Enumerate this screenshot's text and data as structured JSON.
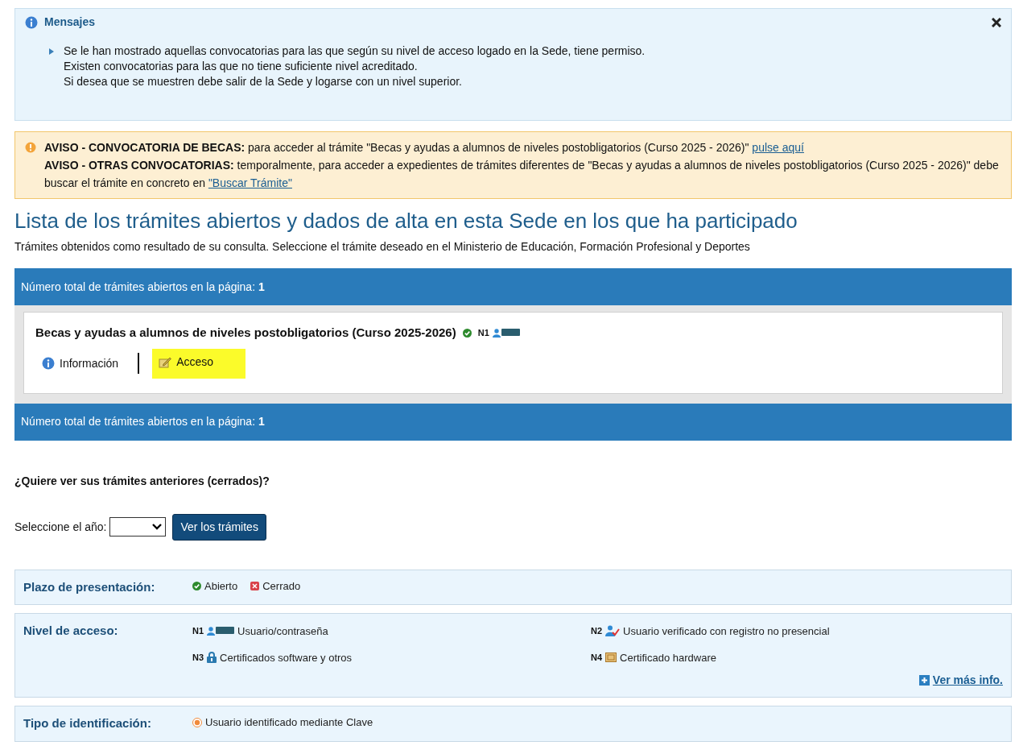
{
  "messages": {
    "title": "Mensajes",
    "items": [
      {
        "lines": [
          "Se le han mostrado aquellas convocatorias para las que según su nivel de acceso logado en la Sede, tiene permiso.",
          "Existen convocatorias para las que no tiene suficiente nivel acreditado.",
          "Si desea que se muestren debe salir de la Sede y logarse con un nivel superior."
        ]
      }
    ]
  },
  "notices": [
    {
      "text": "**AVISO - CONVOCATORIA DE BECAS:** para acceder al trámite \"Becas y ayudas a alumnos de niveles postobligatorios (Curso 2025 - 2026)\"",
      "link": "pulse aquí"
    },
    {
      "text": "**AVISO - OTRAS CONVOCATORIAS:** temporalmente, para acceder a expedientes de trámites diferentes de \"Becas y ayudas a alumnos de niveles postobligatorios (Curso 2025 - 2026)\" debe buscar el trámite en concreto en",
      "link": "\"Buscar Trámite\""
    }
  ],
  "heading": "Lista de los trámites abiertos y dados de alta en esta Sede en los que ha participado",
  "subtitle": "Trámites obtenidos como resultado de su consulta. Seleccione el trámite deseado en el Ministerio de Educación, Formación Profesional y Deportes",
  "count_bars": [
    "Número total de trámites abiertos en la página: **1**",
    "Número total de trámites abiertos en la página: **1**"
  ],
  "procedures": [
    {
      "title": "Becas y ayudas a alumnos de niveles postobligatorios (Curso 2025-2026)",
      "open": true,
      "level": "N1",
      "actions": [
        {
          "kind": "info",
          "label": "Información",
          "highlighted": false
        },
        {
          "kind": "access",
          "label": "Acceso",
          "highlighted": true
        }
      ]
    }
  ],
  "closed": {
    "question": "¿Quiere ver sus trámites anteriores (cerrados)?",
    "year_label": "Seleccione el año:",
    "button": "Ver los trámites"
  },
  "legend": [
    {
      "label": "Plazo de presentación:",
      "kind": "inline",
      "items": [
        {
          "kind": "open",
          "text": "Abierto"
        },
        {
          "kind": "closed",
          "text": "Cerrado"
        }
      ]
    },
    {
      "label": "Nivel de acceso:",
      "kind": "grid",
      "items": [
        {
          "code": "N1",
          "kind": "user-pass",
          "text": "Usuario/contraseña"
        },
        {
          "code": "N2",
          "kind": "verified",
          "text": "Usuario verificado con registro no presencial"
        },
        {
          "code": "N3",
          "kind": "software",
          "text": "Certificados software y otros"
        },
        {
          "code": "N4",
          "kind": "hardware",
          "text": "Certificado hardware"
        }
      ],
      "more_link": "Ver más info."
    },
    {
      "label": "Tipo de identificación:",
      "kind": "inline",
      "items": [
        {
          "kind": "clave",
          "text": "Usuario identificado mediante Clave"
        }
      ]
    }
  ]
}
